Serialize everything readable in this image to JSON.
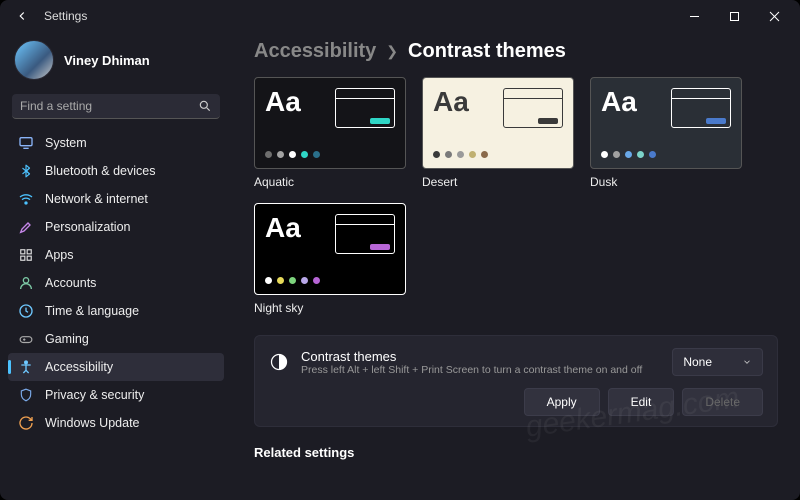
{
  "window": {
    "title": "Settings"
  },
  "user": {
    "name": "Viney Dhiman",
    "email": ""
  },
  "search": {
    "placeholder": "Find a setting"
  },
  "sidebar": {
    "items": [
      {
        "label": "System",
        "icon": "system"
      },
      {
        "label": "Bluetooth & devices",
        "icon": "bluetooth"
      },
      {
        "label": "Network & internet",
        "icon": "wifi"
      },
      {
        "label": "Personalization",
        "icon": "personalization"
      },
      {
        "label": "Apps",
        "icon": "apps"
      },
      {
        "label": "Accounts",
        "icon": "accounts"
      },
      {
        "label": "Time & language",
        "icon": "time"
      },
      {
        "label": "Gaming",
        "icon": "gaming"
      },
      {
        "label": "Accessibility",
        "icon": "accessibility",
        "active": true
      },
      {
        "label": "Privacy & security",
        "icon": "privacy"
      },
      {
        "label": "Windows Update",
        "icon": "update"
      }
    ]
  },
  "breadcrumb": {
    "parent": "Accessibility",
    "current": "Contrast themes"
  },
  "themes": [
    {
      "name": "Aquatic",
      "bg": "#141418",
      "fg": "#ffffff",
      "miniBorder": "#ffffff",
      "btn": "#2fd6c6",
      "dots": [
        "#6e6e6e",
        "#a2a2a2",
        "#ffffff",
        "#2fd6c6",
        "#2a6f8a"
      ]
    },
    {
      "name": "Desert",
      "bg": "#f6f1e1",
      "fg": "#3a3a3a",
      "miniBorder": "#3a3a3a",
      "btn": "#3a3a3a",
      "dots": [
        "#3a3a3a",
        "#7a7a7a",
        "#9a9a9a",
        "#c0b070",
        "#8a6a4a"
      ]
    },
    {
      "name": "Dusk",
      "bg": "#2a2f36",
      "fg": "#ffffff",
      "miniBorder": "#ffffff",
      "btn": "#4a7acb",
      "dots": [
        "#ffffff",
        "#a0a0a0",
        "#69a8e8",
        "#7cd3c9",
        "#4a7acb"
      ]
    },
    {
      "name": "Night sky",
      "bg": "#000000",
      "fg": "#ffffff",
      "miniBorder": "#ffffff",
      "btn": "#b765d6",
      "dots": [
        "#ffffff",
        "#e6d95a",
        "#7cd37c",
        "#b8a7e8",
        "#b765d6"
      ]
    }
  ],
  "contrast_setting": {
    "title": "Contrast themes",
    "subtitle": "Press left Alt + left Shift + Print Screen to turn a contrast theme on and off",
    "dropdown_value": "None",
    "buttons": {
      "apply": "Apply",
      "edit": "Edit",
      "delete": "Delete"
    }
  },
  "related_heading": "Related settings",
  "watermark": "geekermag.com"
}
